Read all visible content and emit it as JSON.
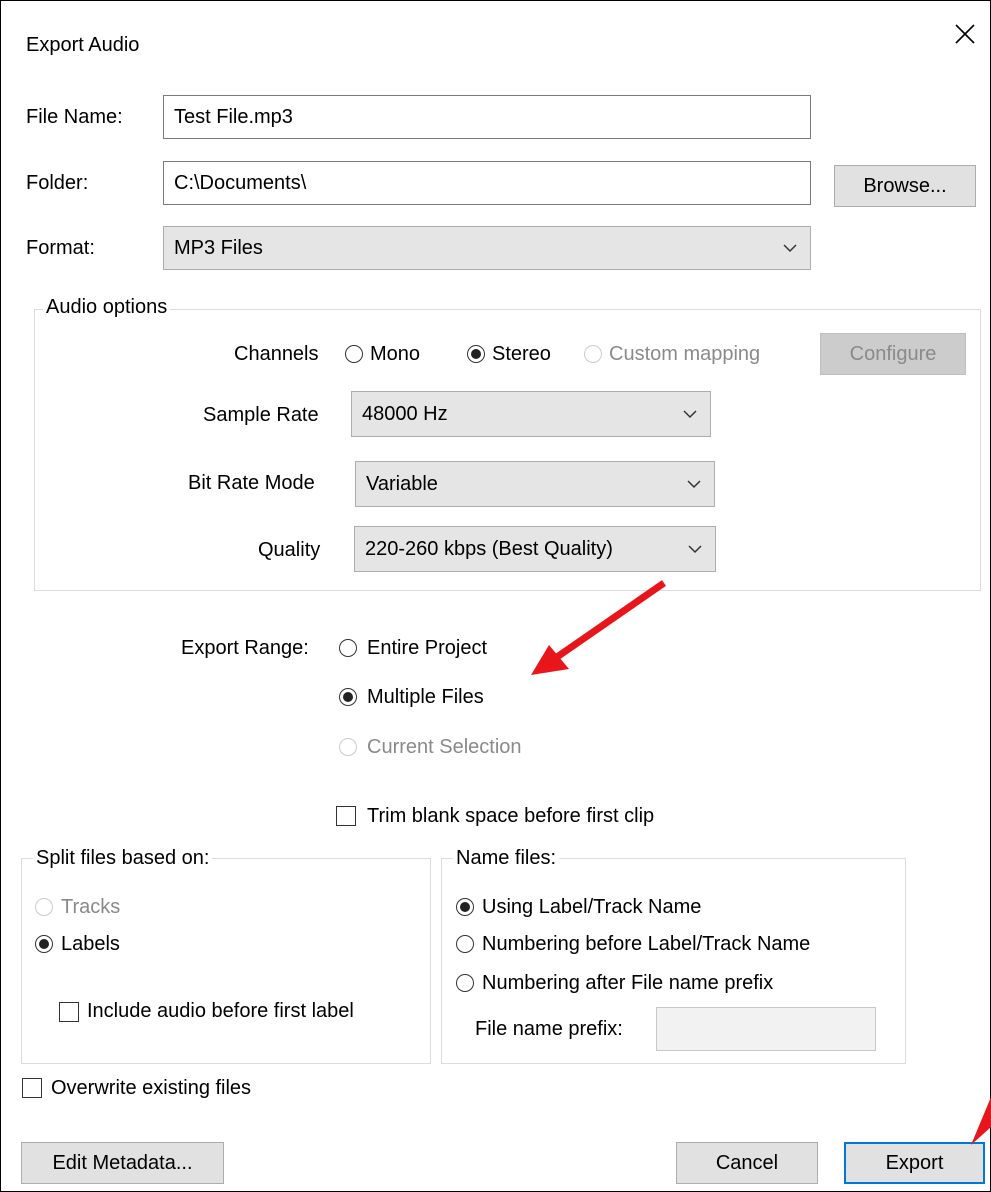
{
  "window": {
    "title": "Export Audio",
    "close_icon": "close-icon"
  },
  "file": {
    "file_name_label": "File Name:",
    "file_name_value": "Test File.mp3",
    "folder_label": "Folder:",
    "folder_value": "C:\\Documents\\",
    "browse_label": "Browse...",
    "format_label": "Format:",
    "format_value": "MP3 Files"
  },
  "audio_options": {
    "title": "Audio options",
    "channels_label": "Channels",
    "mono": "Mono",
    "stereo": "Stereo",
    "custom_mapping": "Custom mapping",
    "configure": "Configure",
    "sample_rate_label": "Sample Rate",
    "sample_rate_value": "48000 Hz",
    "bit_rate_mode_label": "Bit Rate Mode",
    "bit_rate_mode_value": "Variable",
    "quality_label": "Quality",
    "quality_value": "220-260 kbps (Best Quality)"
  },
  "export_range": {
    "label": "Export Range:",
    "entire_project": "Entire Project",
    "multiple_files": "Multiple Files",
    "current_selection": "Current Selection",
    "selected": "Multiple Files"
  },
  "trim_label": "Trim blank space before first clip",
  "split": {
    "title": "Split files based on:",
    "tracks": "Tracks",
    "labels": "Labels",
    "include_audio": "Include audio before first label"
  },
  "name_files": {
    "title": "Name files:",
    "using_label": "Using Label/Track Name",
    "numbering_before": "Numbering before Label/Track Name",
    "numbering_after": "Numbering after File name prefix",
    "prefix_label": "File name prefix:",
    "prefix_value": ""
  },
  "overwrite_label": "Overwrite existing files",
  "buttons": {
    "edit_metadata": "Edit Metadata...",
    "cancel": "Cancel",
    "export": "Export"
  },
  "colors": {
    "accent": "#0078d7",
    "annotation_arrow": "#e8161b",
    "disabled": "#8a8a8a"
  }
}
